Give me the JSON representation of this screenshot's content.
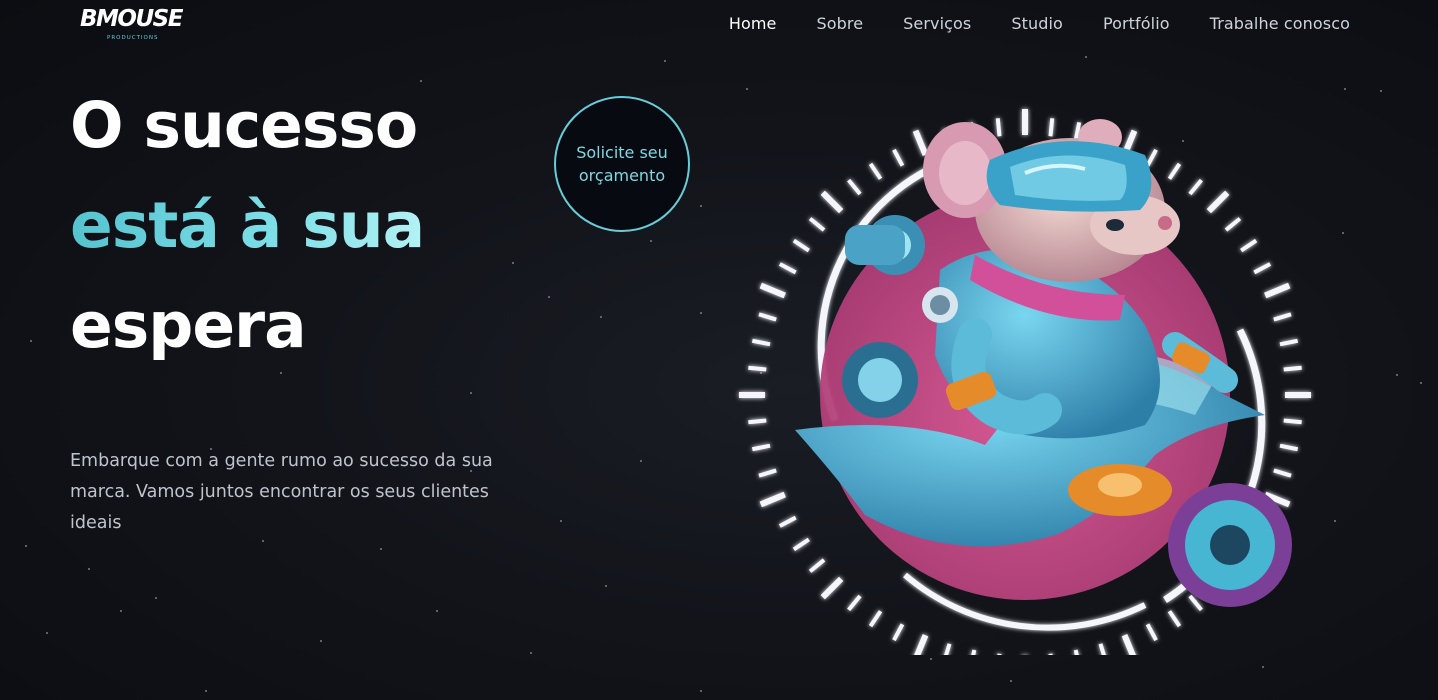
{
  "brand": {
    "logo_text": "BMOUSE",
    "logo_subtitle": "PRODUCTIONS",
    "accent_color": "#6dd3de"
  },
  "nav": {
    "items": [
      {
        "label": "Home",
        "active": true
      },
      {
        "label": "Sobre",
        "active": false
      },
      {
        "label": "Serviços",
        "active": false
      },
      {
        "label": "Studio",
        "active": false
      },
      {
        "label": "Portfólio",
        "active": false
      },
      {
        "label": "Trabalhe conosco",
        "active": false
      }
    ]
  },
  "hero": {
    "title_line1": "O sucesso",
    "title_line2": "está à sua",
    "title_line3": "espera",
    "description": "Embarque com a gente rumo ao sucesso da sua marca. Vamos juntos encontrar os seus clientes ideais",
    "cta_label": "Solicite seu orçamento",
    "illustration": "astronaut-mouse-on-motorcycle"
  }
}
